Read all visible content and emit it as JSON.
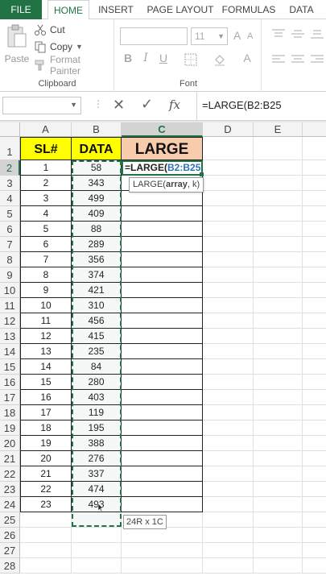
{
  "ribbon_tabs": {
    "file": "FILE",
    "home": "HOME",
    "insert": "INSERT",
    "page_layout": "PAGE LAYOUT",
    "formulas": "FORMULAS",
    "data": "DATA"
  },
  "clipboard": {
    "paste": "Paste",
    "cut": "Cut",
    "copy": "Copy",
    "format_painter": "Format Painter",
    "group_label": "Clipboard"
  },
  "font": {
    "size": "11",
    "bold": "B",
    "italic": "I",
    "underline": "U",
    "grow": "A",
    "shrink": "A",
    "font_color": "A",
    "group_label": "Font"
  },
  "formula_bar": {
    "cancel": "✕",
    "enter": "✓",
    "fx": "fx",
    "value": "=LARGE(B2:B25"
  },
  "columns": [
    "A",
    "B",
    "C",
    "D",
    "E"
  ],
  "rows": [
    "1",
    "2",
    "3",
    "4",
    "5",
    "6",
    "7",
    "8",
    "9",
    "10",
    "11",
    "12",
    "13",
    "14",
    "15",
    "16",
    "17",
    "18",
    "19",
    "20",
    "21",
    "22",
    "23",
    "24",
    "25",
    "26",
    "27",
    "28"
  ],
  "headers": {
    "a": "SL#",
    "b": "DATA",
    "c": "LARGE"
  },
  "table": {
    "sl": [
      "1",
      "2",
      "3",
      "4",
      "5",
      "6",
      "7",
      "8",
      "9",
      "10",
      "11",
      "12",
      "13",
      "14",
      "15",
      "16",
      "17",
      "18",
      "19",
      "20",
      "21",
      "22",
      "23"
    ],
    "data": [
      "58",
      "343",
      "499",
      "409",
      "88",
      "289",
      "356",
      "374",
      "421",
      "310",
      "456",
      "415",
      "235",
      "84",
      "280",
      "403",
      "119",
      "195",
      "388",
      "276",
      "337",
      "474",
      "493"
    ]
  },
  "active_cell": {
    "prefix": "=LARGE(",
    "ref": "B2:B25"
  },
  "tooltip": {
    "fn": "LARGE(",
    "arg1": "array",
    "rest": ", k)"
  },
  "selection_size": "24R x 1C",
  "colors": {
    "accent": "#217346",
    "header_yellow": "#ffff00",
    "header_peach": "#f8cbad",
    "ref_blue": "#2f6fb5"
  }
}
